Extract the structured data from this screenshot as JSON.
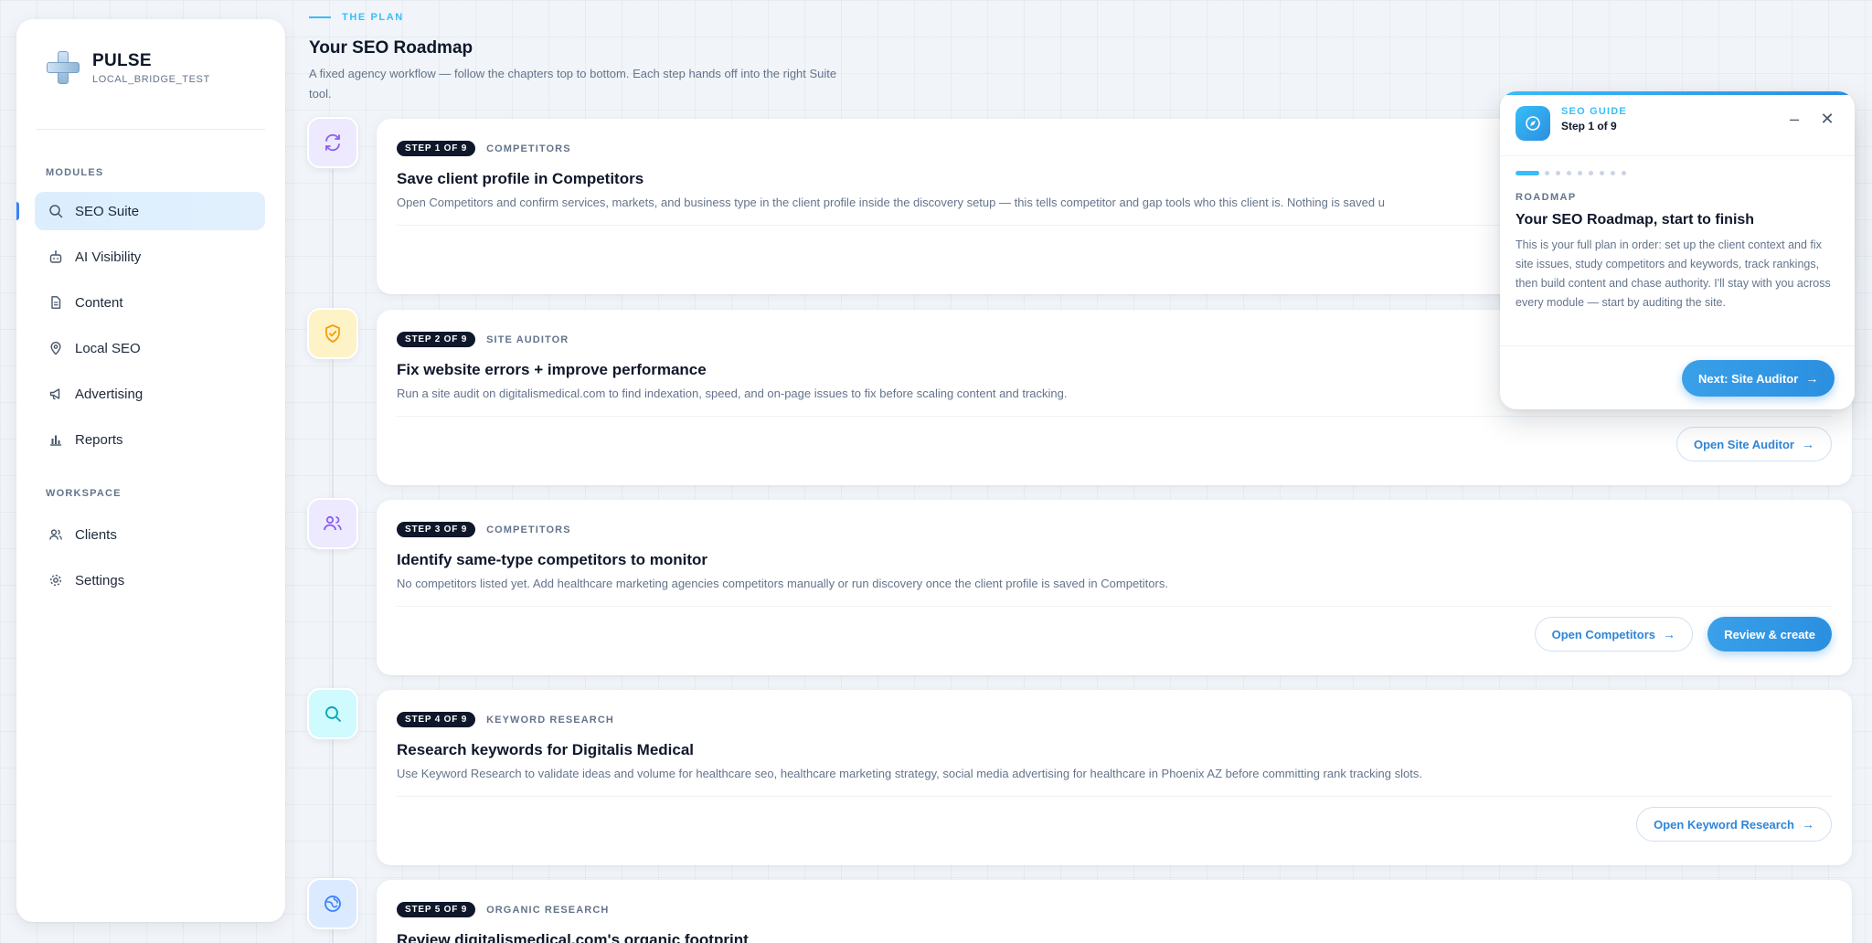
{
  "brand": {
    "name": "PULSE",
    "subtitle": "LOCAL_BRIDGE_TEST"
  },
  "sidebar": {
    "modules_label": "MODULES",
    "workspace_label": "WORKSPACE",
    "modules": [
      {
        "label": "SEO Suite",
        "icon": "search-icon",
        "active": true
      },
      {
        "label": "AI Visibility",
        "icon": "robot-icon",
        "active": false
      },
      {
        "label": "Content",
        "icon": "document-icon",
        "active": false
      },
      {
        "label": "Local SEO",
        "icon": "map-pin-icon",
        "active": false
      },
      {
        "label": "Advertising",
        "icon": "megaphone-icon",
        "active": false
      },
      {
        "label": "Reports",
        "icon": "bar-chart-icon",
        "active": false
      }
    ],
    "workspace": [
      {
        "label": "Clients",
        "icon": "users-icon"
      },
      {
        "label": "Settings",
        "icon": "gear-icon"
      }
    ]
  },
  "header": {
    "eyebrow": "THE PLAN",
    "title": "Your SEO Roadmap",
    "description": "A fixed agency workflow — follow the chapters top to bottom. Each step hands off into the right Suite tool."
  },
  "steps": [
    {
      "step": "STEP 1 OF 9",
      "category": "COMPETITORS",
      "icon": "refresh-icon",
      "icon_color": "#8b5cf6",
      "title": "Save client profile in Competitors",
      "description": "Open Competitors and confirm services, markets, and business type in the client profile inside the discovery setup — this tells competitor and gap tools who this client is. Nothing is saved u"
    },
    {
      "step": "STEP 2 OF 9",
      "category": "SITE AUDITOR",
      "icon": "shield-check-icon",
      "icon_color": "#f59e0b",
      "title": "Fix website errors + improve performance",
      "description": "Run a site audit on digitalismedical.com to find indexation, speed, and on-page issues to fix before scaling content and tracking.",
      "button": "Open Site Auditor"
    },
    {
      "step": "STEP 3 OF 9",
      "category": "COMPETITORS",
      "icon": "users-icon",
      "icon_color": "#8b5cf6",
      "title": "Identify same-type competitors to monitor",
      "description": "No competitors listed yet. Add healthcare marketing agencies competitors manually or run discovery once the client profile is saved in Competitors.",
      "button": "Open Competitors",
      "primary_button": "Review & create"
    },
    {
      "step": "STEP 4 OF 9",
      "category": "KEYWORD RESEARCH",
      "icon": "search-icon",
      "icon_color": "#0ea5b7",
      "title": "Research keywords for Digitalis Medical",
      "description": "Use Keyword Research to validate ideas and volume for healthcare seo, healthcare marketing strategy, social media advertising for healthcare in Phoenix AZ before committing rank tracking slots.",
      "button": "Open Keyword Research"
    },
    {
      "step": "STEP 5 OF 9",
      "category": "ORGANIC RESEARCH",
      "icon": "globe-icon",
      "icon_color": "#3b82f6",
      "title": "Review digitalismedical.com's organic footprint"
    }
  ],
  "guide": {
    "label": "SEO GUIDE",
    "step": "Step 1 of 9",
    "eyebrow": "ROADMAP",
    "title": "Your SEO Roadmap, start to finish",
    "body": "This is your full plan in order: set up the client context and fix site issues, study competitors and keywords, track rankings, then build content and chase authority. I'll stay with you across every module — start by auditing the site.",
    "next_button": "Next: Site Auditor",
    "progress": {
      "current": 1,
      "total": 9
    }
  },
  "colors": {
    "accent": "#38bdf8",
    "primary": "#2b8fe0",
    "navy": "#0f172a"
  }
}
